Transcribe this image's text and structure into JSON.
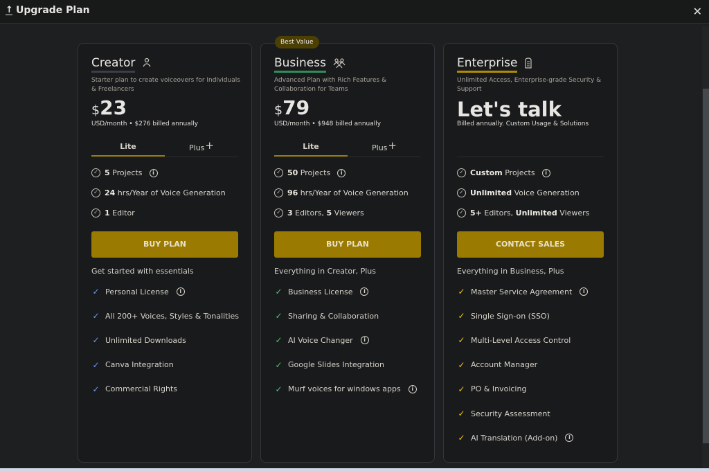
{
  "window": {
    "title": "Upgrade Plan",
    "title_icon": "upload-icon",
    "close_icon": "close-icon",
    "close_glyph": "✕"
  },
  "colors": {
    "accent": "#9a7a00",
    "creator_underline": "#3b3f47",
    "business_underline": "#2f8f5b",
    "enterprise_underline": "#b08d00",
    "creator_check": "#6d9cf5",
    "business_check": "#4cc47a",
    "enterprise_check": "#f0c419",
    "badge_bg": "#4c3f03"
  },
  "badge": "Best Value",
  "plans": [
    {
      "name": "Creator",
      "icon": "user-icon",
      "icon_glyph": "⍝",
      "description": "Starter plan to create voiceovers for Individuals & Freelancers",
      "currency": "$",
      "price": "23",
      "price_sub": "USD/month  •  $276 billed annually",
      "tabs": [
        {
          "label": "Lite",
          "active": true
        },
        {
          "label": "Plus",
          "suffix": "+",
          "active": false
        }
      ],
      "quotas": [
        {
          "bold": "5",
          "text": " Projects",
          "info": true
        },
        {
          "bold": "24",
          "text": " hrs/Year of Voice Generation",
          "info": false
        },
        {
          "bold": "1",
          "text": " Editor",
          "info": false
        }
      ],
      "button": "BUY PLAN",
      "features_heading": "Get started with essentials",
      "features": [
        {
          "text": "Personal License",
          "info": true
        },
        {
          "text": "All 200+ Voices, Styles & Tonalities",
          "info": false
        },
        {
          "text": "Unlimited Downloads",
          "info": false
        },
        {
          "text": "Canva Integration",
          "info": false
        },
        {
          "text": "Commercial Rights",
          "info": false
        }
      ]
    },
    {
      "name": "Business",
      "icon": "users-group-icon",
      "icon_glyph": "⚇",
      "description": "Advanced Plan with Rich Features & Collaboration for Teams",
      "currency": "$",
      "price": "79",
      "price_sub": "USD/month  •  $948 billed annually",
      "tabs": [
        {
          "label": "Lite",
          "active": true
        },
        {
          "label": "Plus",
          "suffix": "+",
          "active": false
        }
      ],
      "quotas": [
        {
          "bold": "50",
          "text": " Projects",
          "info": true
        },
        {
          "bold": "96",
          "text": " hrs/Year of Voice Generation",
          "info": false
        },
        {
          "bold": "3",
          "text": " Editors,  ",
          "bold2": "5",
          "text2": " Viewers",
          "info": false
        }
      ],
      "button": "BUY PLAN",
      "features_heading": "Everything in Creator, Plus",
      "features": [
        {
          "text": "Business License",
          "info": true
        },
        {
          "text": "Sharing & Collaboration",
          "info": false
        },
        {
          "text": "AI Voice Changer",
          "info": true
        },
        {
          "text": "Google Slides Integration",
          "info": false
        },
        {
          "text": "Murf voices for windows apps",
          "info": true
        }
      ]
    },
    {
      "name": "Enterprise",
      "icon": "building-icon",
      "icon_glyph": "▤",
      "description": "Unlimited Access, Enterprise-grade Security & Support",
      "price_text": "Let's talk",
      "price_sub": "Billed annually. Custom Usage & Solutions",
      "quotas": [
        {
          "bold": "Custom",
          "text": "  Projects",
          "info": true
        },
        {
          "bold": "Unlimited",
          "text": " Voice Generation",
          "info": false
        },
        {
          "bold": "5+",
          "text": " Editors,  ",
          "bold2": "Unlimited",
          "text2": " Viewers",
          "info": false
        }
      ],
      "button": "CONTACT SALES",
      "features_heading": "Everything in Business, Plus",
      "features": [
        {
          "text": "Master Service Agreement",
          "info": true
        },
        {
          "text": "Single Sign-on (SSO)",
          "info": false
        },
        {
          "text": "Multi-Level Access Control",
          "info": false
        },
        {
          "text": "Account Manager",
          "info": false
        },
        {
          "text": "PO & Invoicing",
          "info": false
        },
        {
          "text": "Security Assessment",
          "info": false
        },
        {
          "text": "AI Translation (Add-on)",
          "info": true
        }
      ]
    }
  ],
  "glyphs": {
    "check_circle": "✓",
    "tick": "✓",
    "info": "i"
  }
}
